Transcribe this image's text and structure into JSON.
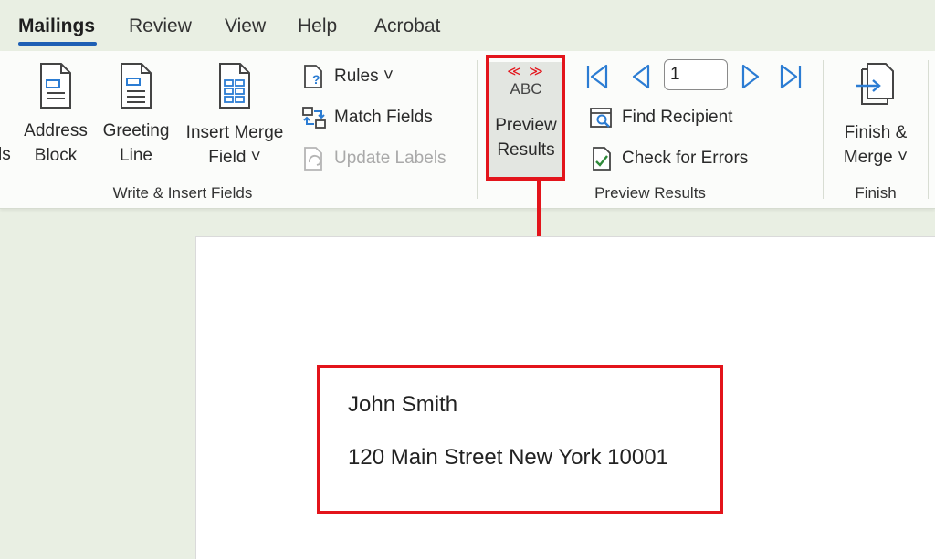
{
  "tabs": [
    {
      "label": "Mailings",
      "active": true
    },
    {
      "label": "Review"
    },
    {
      "label": "View"
    },
    {
      "label": "Help"
    },
    {
      "label": "Acrobat"
    }
  ],
  "write_insert": {
    "cut_label": "ls",
    "address_block": [
      "Address",
      "Block"
    ],
    "greeting_line": [
      "Greeting",
      "Line"
    ],
    "insert_merge_field": [
      "Insert Merge",
      "Field ˅"
    ],
    "rules": "Rules ˅",
    "match_fields": "Match Fields",
    "update_labels": "Update Labels",
    "group_label": "Write & Insert Fields"
  },
  "preview": {
    "abc_glyph": "≪ ≫",
    "abc_text": "ABC",
    "preview_results": [
      "Preview",
      "Results"
    ],
    "record_number": "1",
    "find_recipient": "Find Recipient",
    "check_for_errors": "Check for Errors",
    "group_label": "Preview Results"
  },
  "finish": {
    "finish_merge": [
      "Finish &",
      "Merge ˅"
    ],
    "group_label": "Finish"
  },
  "document": {
    "name": "John Smith",
    "address": "120 Main Street New York 10001"
  },
  "colors": {
    "highlight": "#e3141b",
    "nav_blue": "#2b7cd3",
    "tab_underline": "#1e5fb4"
  }
}
